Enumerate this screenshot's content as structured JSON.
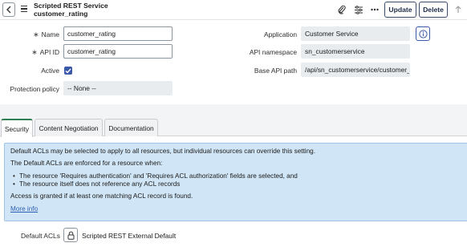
{
  "header": {
    "title_line1": "Scripted REST Service",
    "title_line2": "customer_rating",
    "update_label": "Update",
    "delete_label": "Delete",
    "icons": [
      "back-icon",
      "menu-icon",
      "paperclip-icon",
      "settings-sliders-icon",
      "more-icon",
      "up-arrow-icon"
    ]
  },
  "form": {
    "name_label": "Name",
    "name_value": "customer_rating",
    "api_id_label": "API ID",
    "api_id_value": "customer_rating",
    "active_label": "Active",
    "active_checked": true,
    "protection_label": "Protection policy",
    "protection_value": "-- None --",
    "application_label": "Application",
    "application_value": "Customer Service",
    "namespace_label": "API namespace",
    "namespace_value": "sn_customerservice",
    "base_path_label": "Base API path",
    "base_path_value": "/api/sn_customerservice/customer_r",
    "required_marker": "∗"
  },
  "tabs": [
    {
      "label": "Security",
      "active": true
    },
    {
      "label": "Content Negotiation",
      "active": false
    },
    {
      "label": "Documentation",
      "active": false
    }
  ],
  "security": {
    "intro": "Default ACLs may be selected to apply to all resources, but individual resources can override this setting.",
    "enforced_heading": "The Default ACLs are enforced for a resource when:",
    "bullet_1": "The resource 'Requires authentication' and 'Requires ACL authorization' fields are selected, and",
    "bullet_2": "The resource itself does not reference any ACL records",
    "access_note": "Access is granted if at least one matching ACL record is found.",
    "more_info": "More info",
    "default_acls_label": "Default ACLs",
    "default_acls_value": "Scripted REST External Default"
  },
  "colors": {
    "accent_blue": "#3c58a8",
    "active_tab_green": "#2f7e56",
    "info_bg": "#d0e5f5"
  }
}
